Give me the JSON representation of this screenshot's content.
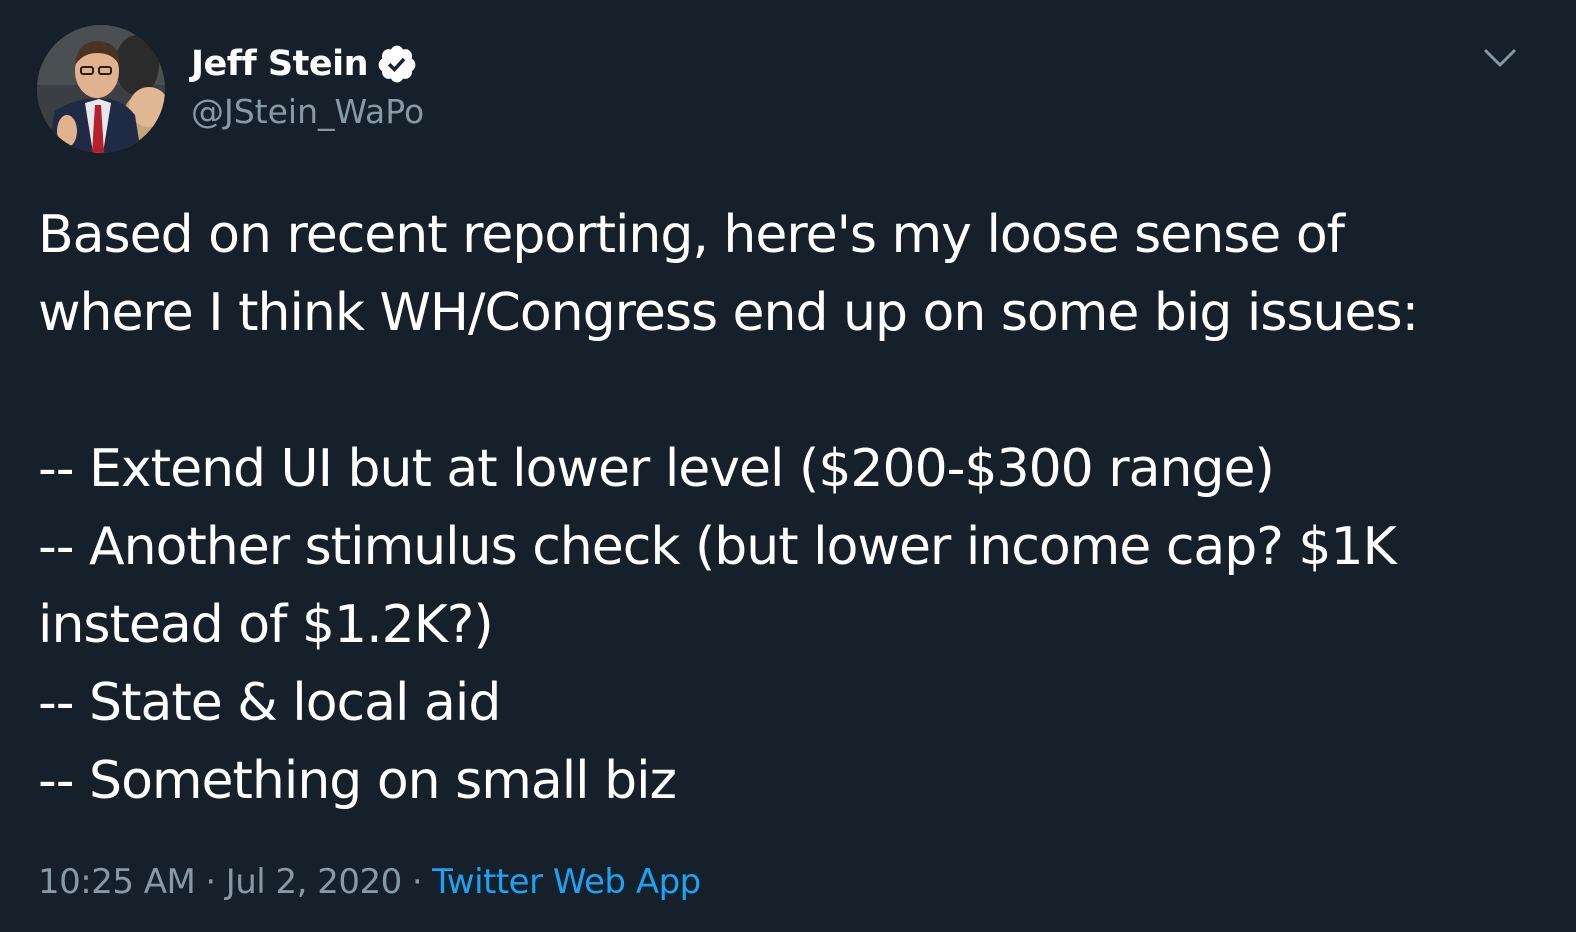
{
  "author": {
    "display_name": "Jeff Stein",
    "handle": "@JStein_WaPo",
    "verified": true
  },
  "tweet": {
    "lines_paragraph1": [
      "Based on recent reporting, here's my loose sense of",
      "where I think WH/Congress end up on some big issues:"
    ],
    "lines_paragraph2": [
      "-- Extend UI but at lower level ($200-$300 range)",
      "-- Another stimulus check (but lower income cap? $1K",
      "instead of $1.2K?)",
      "-- State & local aid",
      "-- Something on small biz"
    ]
  },
  "meta": {
    "time": "10:25 AM",
    "separator": "·",
    "date": "Jul 2, 2020",
    "source": "Twitter Web App"
  },
  "colors": {
    "background": "#15202b",
    "text_primary": "#ffffff",
    "text_secondary": "#8899a6",
    "accent": "#1da1f2"
  },
  "icons": {
    "verified": "verified-badge-icon",
    "menu": "chevron-down-icon"
  }
}
